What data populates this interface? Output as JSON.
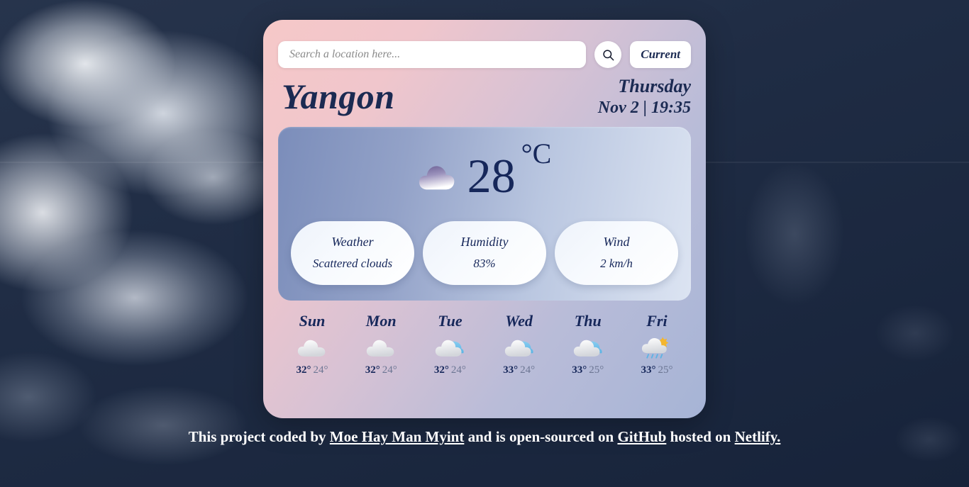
{
  "search": {
    "placeholder": "Search a location here...",
    "value": "",
    "search_icon": "search-icon",
    "current_label": "Current"
  },
  "location": {
    "city": "Yangon",
    "weekday": "Thursday",
    "datetime": "Nov 2 | 19:35"
  },
  "current": {
    "icon": "cloud-icon",
    "temperature": "28",
    "unit": "°C",
    "stats": [
      {
        "label": "Weather",
        "value": "Scattered clouds",
        "name": "weather"
      },
      {
        "label": "Humidity",
        "value": "83%",
        "name": "humidity"
      },
      {
        "label": "Wind",
        "value": "2 km/h",
        "name": "wind"
      }
    ]
  },
  "forecast": [
    {
      "day": "Sun",
      "icon": "cloud-icon",
      "high": "32°",
      "low": "24°"
    },
    {
      "day": "Mon",
      "icon": "cloud-icon",
      "high": "32°",
      "low": "24°"
    },
    {
      "day": "Tue",
      "icon": "partly-cloudy-icon",
      "high": "32°",
      "low": "24°"
    },
    {
      "day": "Wed",
      "icon": "partly-cloudy-icon",
      "high": "33°",
      "low": "24°"
    },
    {
      "day": "Thu",
      "icon": "partly-cloudy-icon",
      "high": "33°",
      "low": "25°"
    },
    {
      "day": "Fri",
      "icon": "sun-rain-cloud-icon",
      "high": "33°",
      "low": "25°"
    }
  ],
  "footer": {
    "text_1": "This project coded by ",
    "link_author": "Moe Hay Man Myint",
    "text_2": " and is open-sourced on ",
    "link_github": "GitHub",
    "text_3": " hosted on ",
    "link_netlify": "Netlify."
  },
  "colors": {
    "card_pink": "#f6c8c8",
    "card_blue": "#a6b4d6",
    "navy_text": "#16275a",
    "sky_navy": "#1f2c44"
  }
}
